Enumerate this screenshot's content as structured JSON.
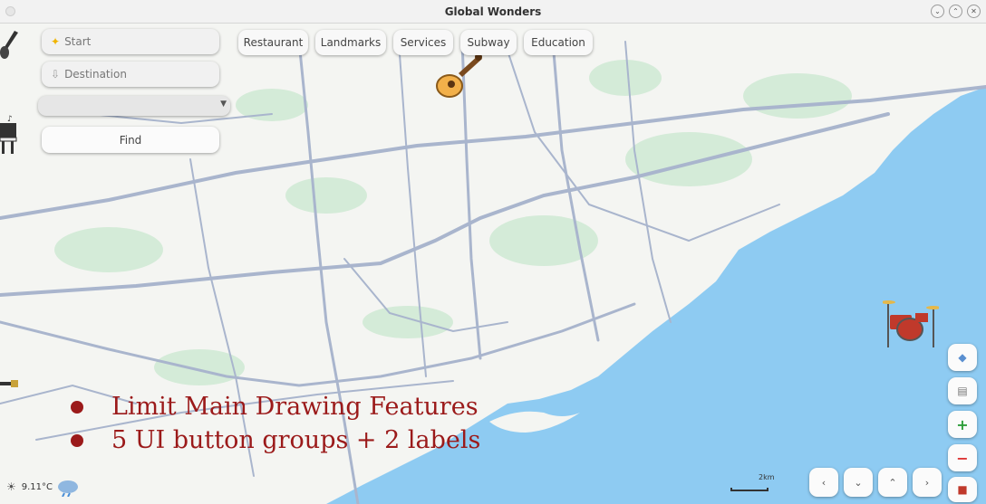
{
  "window": {
    "title": "Global Wonders",
    "controls": [
      "⌄",
      "⌃",
      "✕"
    ]
  },
  "search": {
    "start_placeholder": "Start",
    "destination_placeholder": "Destination",
    "mode_value": "",
    "find_label": "Find"
  },
  "categories": [
    "Restaurant",
    "Landmarks",
    "Services",
    "Subway",
    "Education"
  ],
  "overlay": {
    "lines": [
      "Limit Main Drawing Features",
      "5 UI button groups + 2 labels"
    ]
  },
  "weather": {
    "temperature": "9.11°C",
    "icon": "cloud-rain-icon"
  },
  "scale": {
    "label": "2km"
  },
  "map_controls": {
    "compass_icon": "diamond-nav-icon",
    "layers_icon": "layers-icon",
    "zoom_in": "+",
    "zoom_out": "−",
    "extra_icon": "exit-icon"
  },
  "nav_arrows": [
    "‹",
    "⌄",
    "⌃",
    "›"
  ],
  "decorations": [
    "electric-guitar-icon",
    "acoustic-guitar-icon",
    "piano-icon",
    "drum-kit-icon",
    "guitar-neck-icon"
  ],
  "colors": {
    "water": "#8ecbf2",
    "land": "#f4f5f2",
    "road": "#a9b5cd",
    "park": "#d4ebd8",
    "overlay_text": "#9b1a1a"
  }
}
